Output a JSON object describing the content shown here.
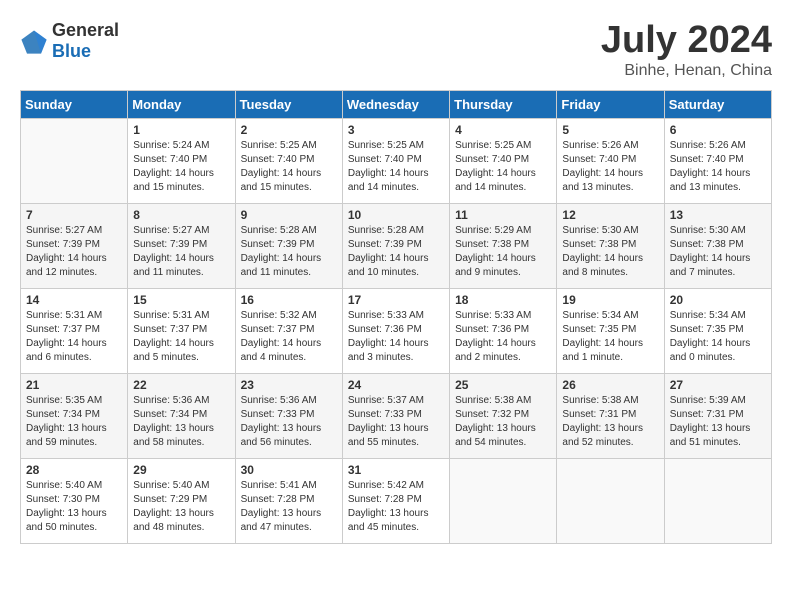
{
  "logo": {
    "general": "General",
    "blue": "Blue"
  },
  "title": "July 2024",
  "location": "Binhe, Henan, China",
  "weekdays": [
    "Sunday",
    "Monday",
    "Tuesday",
    "Wednesday",
    "Thursday",
    "Friday",
    "Saturday"
  ],
  "weeks": [
    [
      {
        "day": "",
        "sunrise": "",
        "sunset": "",
        "daylight": ""
      },
      {
        "day": "1",
        "sunrise": "Sunrise: 5:24 AM",
        "sunset": "Sunset: 7:40 PM",
        "daylight": "Daylight: 14 hours and 15 minutes."
      },
      {
        "day": "2",
        "sunrise": "Sunrise: 5:25 AM",
        "sunset": "Sunset: 7:40 PM",
        "daylight": "Daylight: 14 hours and 15 minutes."
      },
      {
        "day": "3",
        "sunrise": "Sunrise: 5:25 AM",
        "sunset": "Sunset: 7:40 PM",
        "daylight": "Daylight: 14 hours and 14 minutes."
      },
      {
        "day": "4",
        "sunrise": "Sunrise: 5:25 AM",
        "sunset": "Sunset: 7:40 PM",
        "daylight": "Daylight: 14 hours and 14 minutes."
      },
      {
        "day": "5",
        "sunrise": "Sunrise: 5:26 AM",
        "sunset": "Sunset: 7:40 PM",
        "daylight": "Daylight: 14 hours and 13 minutes."
      },
      {
        "day": "6",
        "sunrise": "Sunrise: 5:26 AM",
        "sunset": "Sunset: 7:40 PM",
        "daylight": "Daylight: 14 hours and 13 minutes."
      }
    ],
    [
      {
        "day": "7",
        "sunrise": "Sunrise: 5:27 AM",
        "sunset": "Sunset: 7:39 PM",
        "daylight": "Daylight: 14 hours and 12 minutes."
      },
      {
        "day": "8",
        "sunrise": "Sunrise: 5:27 AM",
        "sunset": "Sunset: 7:39 PM",
        "daylight": "Daylight: 14 hours and 11 minutes."
      },
      {
        "day": "9",
        "sunrise": "Sunrise: 5:28 AM",
        "sunset": "Sunset: 7:39 PM",
        "daylight": "Daylight: 14 hours and 11 minutes."
      },
      {
        "day": "10",
        "sunrise": "Sunrise: 5:28 AM",
        "sunset": "Sunset: 7:39 PM",
        "daylight": "Daylight: 14 hours and 10 minutes."
      },
      {
        "day": "11",
        "sunrise": "Sunrise: 5:29 AM",
        "sunset": "Sunset: 7:38 PM",
        "daylight": "Daylight: 14 hours and 9 minutes."
      },
      {
        "day": "12",
        "sunrise": "Sunrise: 5:30 AM",
        "sunset": "Sunset: 7:38 PM",
        "daylight": "Daylight: 14 hours and 8 minutes."
      },
      {
        "day": "13",
        "sunrise": "Sunrise: 5:30 AM",
        "sunset": "Sunset: 7:38 PM",
        "daylight": "Daylight: 14 hours and 7 minutes."
      }
    ],
    [
      {
        "day": "14",
        "sunrise": "Sunrise: 5:31 AM",
        "sunset": "Sunset: 7:37 PM",
        "daylight": "Daylight: 14 hours and 6 minutes."
      },
      {
        "day": "15",
        "sunrise": "Sunrise: 5:31 AM",
        "sunset": "Sunset: 7:37 PM",
        "daylight": "Daylight: 14 hours and 5 minutes."
      },
      {
        "day": "16",
        "sunrise": "Sunrise: 5:32 AM",
        "sunset": "Sunset: 7:37 PM",
        "daylight": "Daylight: 14 hours and 4 minutes."
      },
      {
        "day": "17",
        "sunrise": "Sunrise: 5:33 AM",
        "sunset": "Sunset: 7:36 PM",
        "daylight": "Daylight: 14 hours and 3 minutes."
      },
      {
        "day": "18",
        "sunrise": "Sunrise: 5:33 AM",
        "sunset": "Sunset: 7:36 PM",
        "daylight": "Daylight: 14 hours and 2 minutes."
      },
      {
        "day": "19",
        "sunrise": "Sunrise: 5:34 AM",
        "sunset": "Sunset: 7:35 PM",
        "daylight": "Daylight: 14 hours and 1 minute."
      },
      {
        "day": "20",
        "sunrise": "Sunrise: 5:34 AM",
        "sunset": "Sunset: 7:35 PM",
        "daylight": "Daylight: 14 hours and 0 minutes."
      }
    ],
    [
      {
        "day": "21",
        "sunrise": "Sunrise: 5:35 AM",
        "sunset": "Sunset: 7:34 PM",
        "daylight": "Daylight: 13 hours and 59 minutes."
      },
      {
        "day": "22",
        "sunrise": "Sunrise: 5:36 AM",
        "sunset": "Sunset: 7:34 PM",
        "daylight": "Daylight: 13 hours and 58 minutes."
      },
      {
        "day": "23",
        "sunrise": "Sunrise: 5:36 AM",
        "sunset": "Sunset: 7:33 PM",
        "daylight": "Daylight: 13 hours and 56 minutes."
      },
      {
        "day": "24",
        "sunrise": "Sunrise: 5:37 AM",
        "sunset": "Sunset: 7:33 PM",
        "daylight": "Daylight: 13 hours and 55 minutes."
      },
      {
        "day": "25",
        "sunrise": "Sunrise: 5:38 AM",
        "sunset": "Sunset: 7:32 PM",
        "daylight": "Daylight: 13 hours and 54 minutes."
      },
      {
        "day": "26",
        "sunrise": "Sunrise: 5:38 AM",
        "sunset": "Sunset: 7:31 PM",
        "daylight": "Daylight: 13 hours and 52 minutes."
      },
      {
        "day": "27",
        "sunrise": "Sunrise: 5:39 AM",
        "sunset": "Sunset: 7:31 PM",
        "daylight": "Daylight: 13 hours and 51 minutes."
      }
    ],
    [
      {
        "day": "28",
        "sunrise": "Sunrise: 5:40 AM",
        "sunset": "Sunset: 7:30 PM",
        "daylight": "Daylight: 13 hours and 50 minutes."
      },
      {
        "day": "29",
        "sunrise": "Sunrise: 5:40 AM",
        "sunset": "Sunset: 7:29 PM",
        "daylight": "Daylight: 13 hours and 48 minutes."
      },
      {
        "day": "30",
        "sunrise": "Sunrise: 5:41 AM",
        "sunset": "Sunset: 7:28 PM",
        "daylight": "Daylight: 13 hours and 47 minutes."
      },
      {
        "day": "31",
        "sunrise": "Sunrise: 5:42 AM",
        "sunset": "Sunset: 7:28 PM",
        "daylight": "Daylight: 13 hours and 45 minutes."
      },
      {
        "day": "",
        "sunrise": "",
        "sunset": "",
        "daylight": ""
      },
      {
        "day": "",
        "sunrise": "",
        "sunset": "",
        "daylight": ""
      },
      {
        "day": "",
        "sunrise": "",
        "sunset": "",
        "daylight": ""
      }
    ]
  ]
}
